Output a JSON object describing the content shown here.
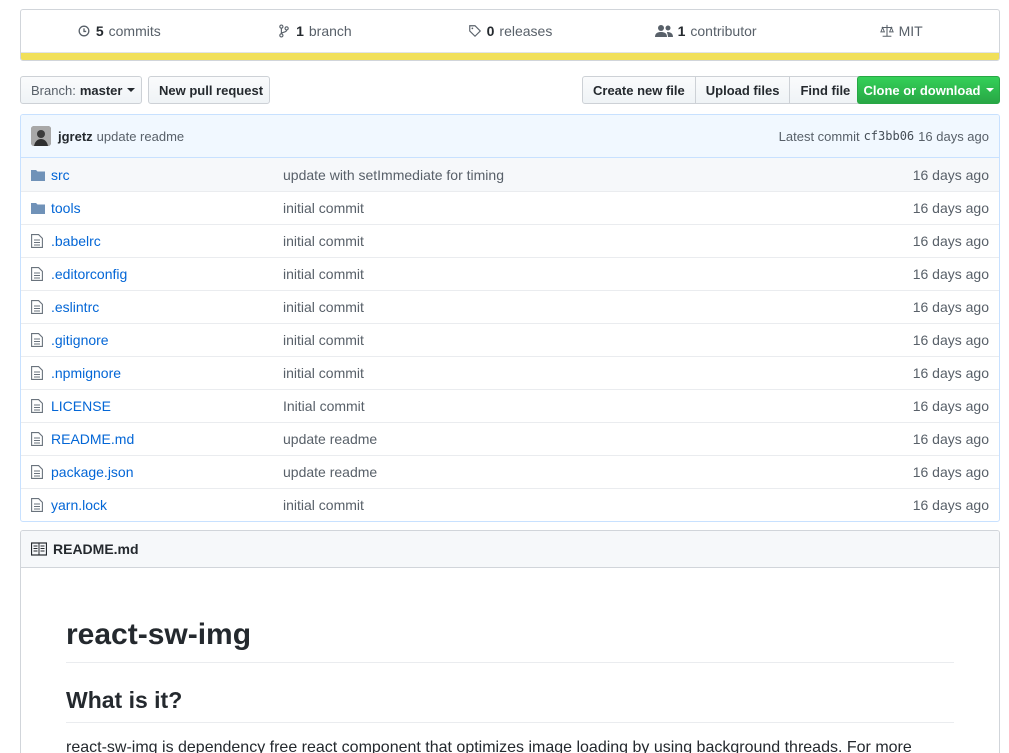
{
  "summary": {
    "commits_count": "5",
    "commits_label": "commits",
    "branch_count": "1",
    "branch_label": "branch",
    "releases_count": "0",
    "releases_label": "releases",
    "contributor_count": "1",
    "contributor_label": "contributor",
    "license": "MIT",
    "language_color": "#f1e05a"
  },
  "toolbar": {
    "branch_prefix": "Branch:",
    "branch_name": "master",
    "new_pr": "New pull request",
    "create_file": "Create new file",
    "upload_files": "Upload files",
    "find_file": "Find file",
    "clone": "Clone or download"
  },
  "commit": {
    "author": "jgretz",
    "message": "update readme",
    "latest_label": "Latest commit",
    "sha": "cf3bb06",
    "age": "16 days ago"
  },
  "files": [
    {
      "type": "dir",
      "name": "src",
      "message": "update with setImmediate for timing",
      "age": "16 days ago"
    },
    {
      "type": "dir",
      "name": "tools",
      "message": "initial commit",
      "age": "16 days ago"
    },
    {
      "type": "file",
      "name": ".babelrc",
      "message": "initial commit",
      "age": "16 days ago"
    },
    {
      "type": "file",
      "name": ".editorconfig",
      "message": "initial commit",
      "age": "16 days ago"
    },
    {
      "type": "file",
      "name": ".eslintrc",
      "message": "initial commit",
      "age": "16 days ago"
    },
    {
      "type": "file",
      "name": ".gitignore",
      "message": "initial commit",
      "age": "16 days ago"
    },
    {
      "type": "file",
      "name": ".npmignore",
      "message": "initial commit",
      "age": "16 days ago"
    },
    {
      "type": "file",
      "name": "LICENSE",
      "message": "Initial commit",
      "age": "16 days ago"
    },
    {
      "type": "file",
      "name": "README.md",
      "message": "update readme",
      "age": "16 days ago"
    },
    {
      "type": "file",
      "name": "package.json",
      "message": "update readme",
      "age": "16 days ago"
    },
    {
      "type": "file",
      "name": "yarn.lock",
      "message": "initial commit",
      "age": "16 days ago"
    }
  ],
  "readme": {
    "filename": "README.md",
    "title": "react-sw-img",
    "subtitle": "What is it?",
    "intro": "react-sw-img is dependency free react component that optimizes image loading by using background threads. For more"
  },
  "icons": {
    "commits": "history-icon",
    "branch": "git-branch-icon",
    "releases": "tag-icon",
    "contributors": "people-icon",
    "license": "law-icon",
    "dir": "folder-icon",
    "file": "file-text-icon",
    "readme": "book-icon"
  }
}
